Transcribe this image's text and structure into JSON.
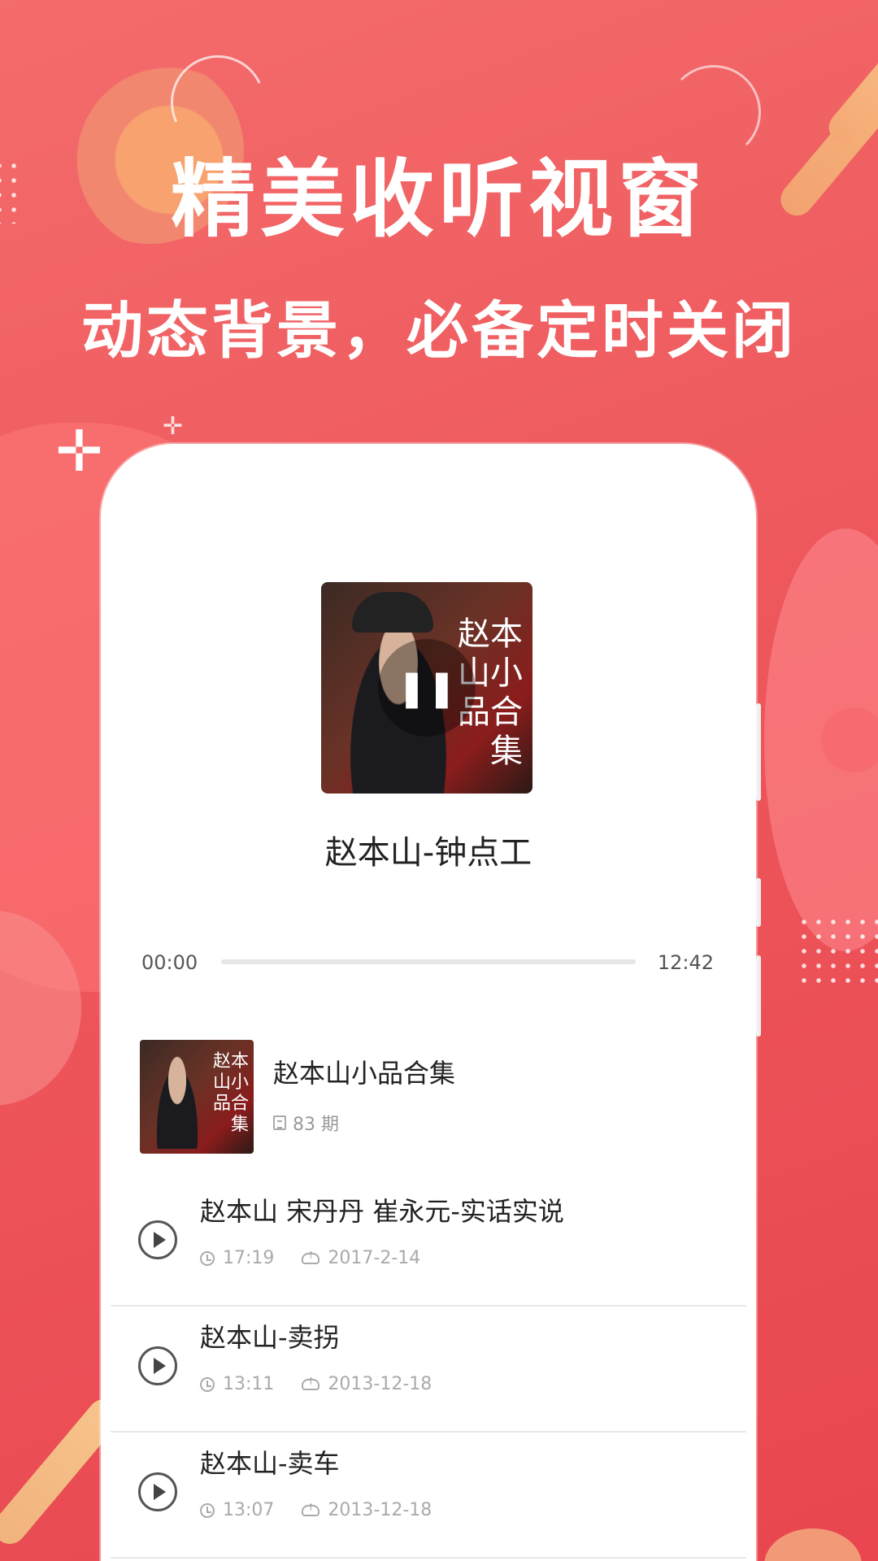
{
  "headline": "精美收听视窗",
  "subheadline": "动态背景，必备定时关闭",
  "player": {
    "cover_art_text": "赵本山小品合集",
    "track_title": "赵本山-钟点工",
    "time_current": "00:00",
    "time_total": "12:42",
    "progress": 0
  },
  "album": {
    "name": "赵本山小品合集",
    "count": "83 期",
    "thumb_text": "赵本山小品合集"
  },
  "episodes": [
    {
      "title": "赵本山 宋丹丹 崔永元-实话实说",
      "duration": "17:19",
      "date": "2017-2-14"
    },
    {
      "title": "赵本山-卖拐",
      "duration": "13:11",
      "date": "2013-12-18"
    },
    {
      "title": "赵本山-卖车",
      "duration": "13:07",
      "date": "2013-12-18"
    }
  ],
  "colors": {
    "background_top": "#f46b6b",
    "background_bottom": "#e9464f",
    "accent": "#e9464f"
  }
}
